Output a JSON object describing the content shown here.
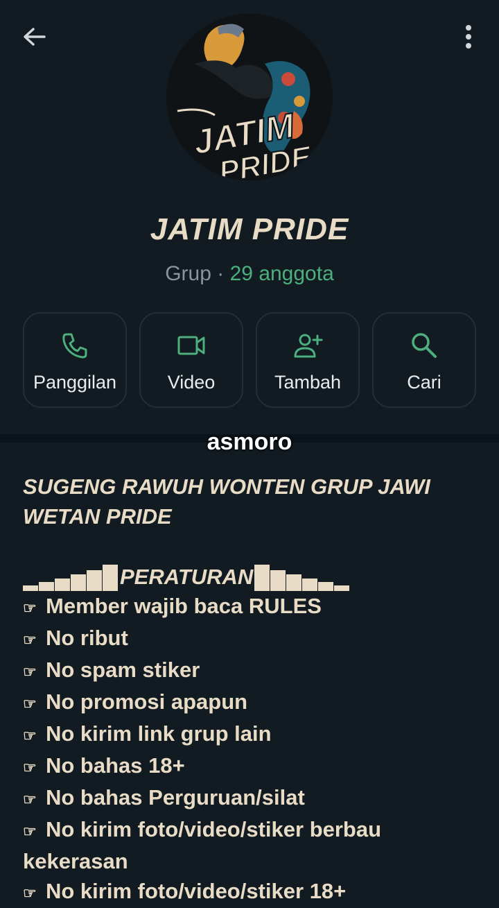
{
  "group": {
    "name": "JATIM PRIDE",
    "type_label": "Grup",
    "separator": "·",
    "member_count": "29 anggota",
    "avatar_text_line1": "JATIM",
    "avatar_text_line2": "PRIDE"
  },
  "actions": [
    {
      "label": "Panggilan",
      "icon": "phone-icon"
    },
    {
      "label": "Video",
      "icon": "video-icon"
    },
    {
      "label": "Tambah",
      "icon": "add-person-icon"
    },
    {
      "label": "Cari",
      "icon": "search-icon"
    }
  ],
  "watermark": "asmoro",
  "description": {
    "title": "SUGENG RAWUH WONTEN GRUP JAWI WETAN PRIDE",
    "rules_heading": "PERATURAN",
    "rule_marker": "☞",
    "rules": [
      "Member wajib baca RULES",
      "No ribut",
      "No spam stiker",
      "No promosi apapun",
      "No kirim link grup lain",
      "No bahas 18+",
      "No bahas Perguruan/silat",
      "No kirim foto/video/stiker berbau kekerasan",
      "No kirim foto/video/stiker 18+"
    ]
  },
  "colors": {
    "background": "#111b21",
    "accent_green": "#4caf7d",
    "text_beige": "#e8dcc6",
    "muted": "#8696a0"
  }
}
